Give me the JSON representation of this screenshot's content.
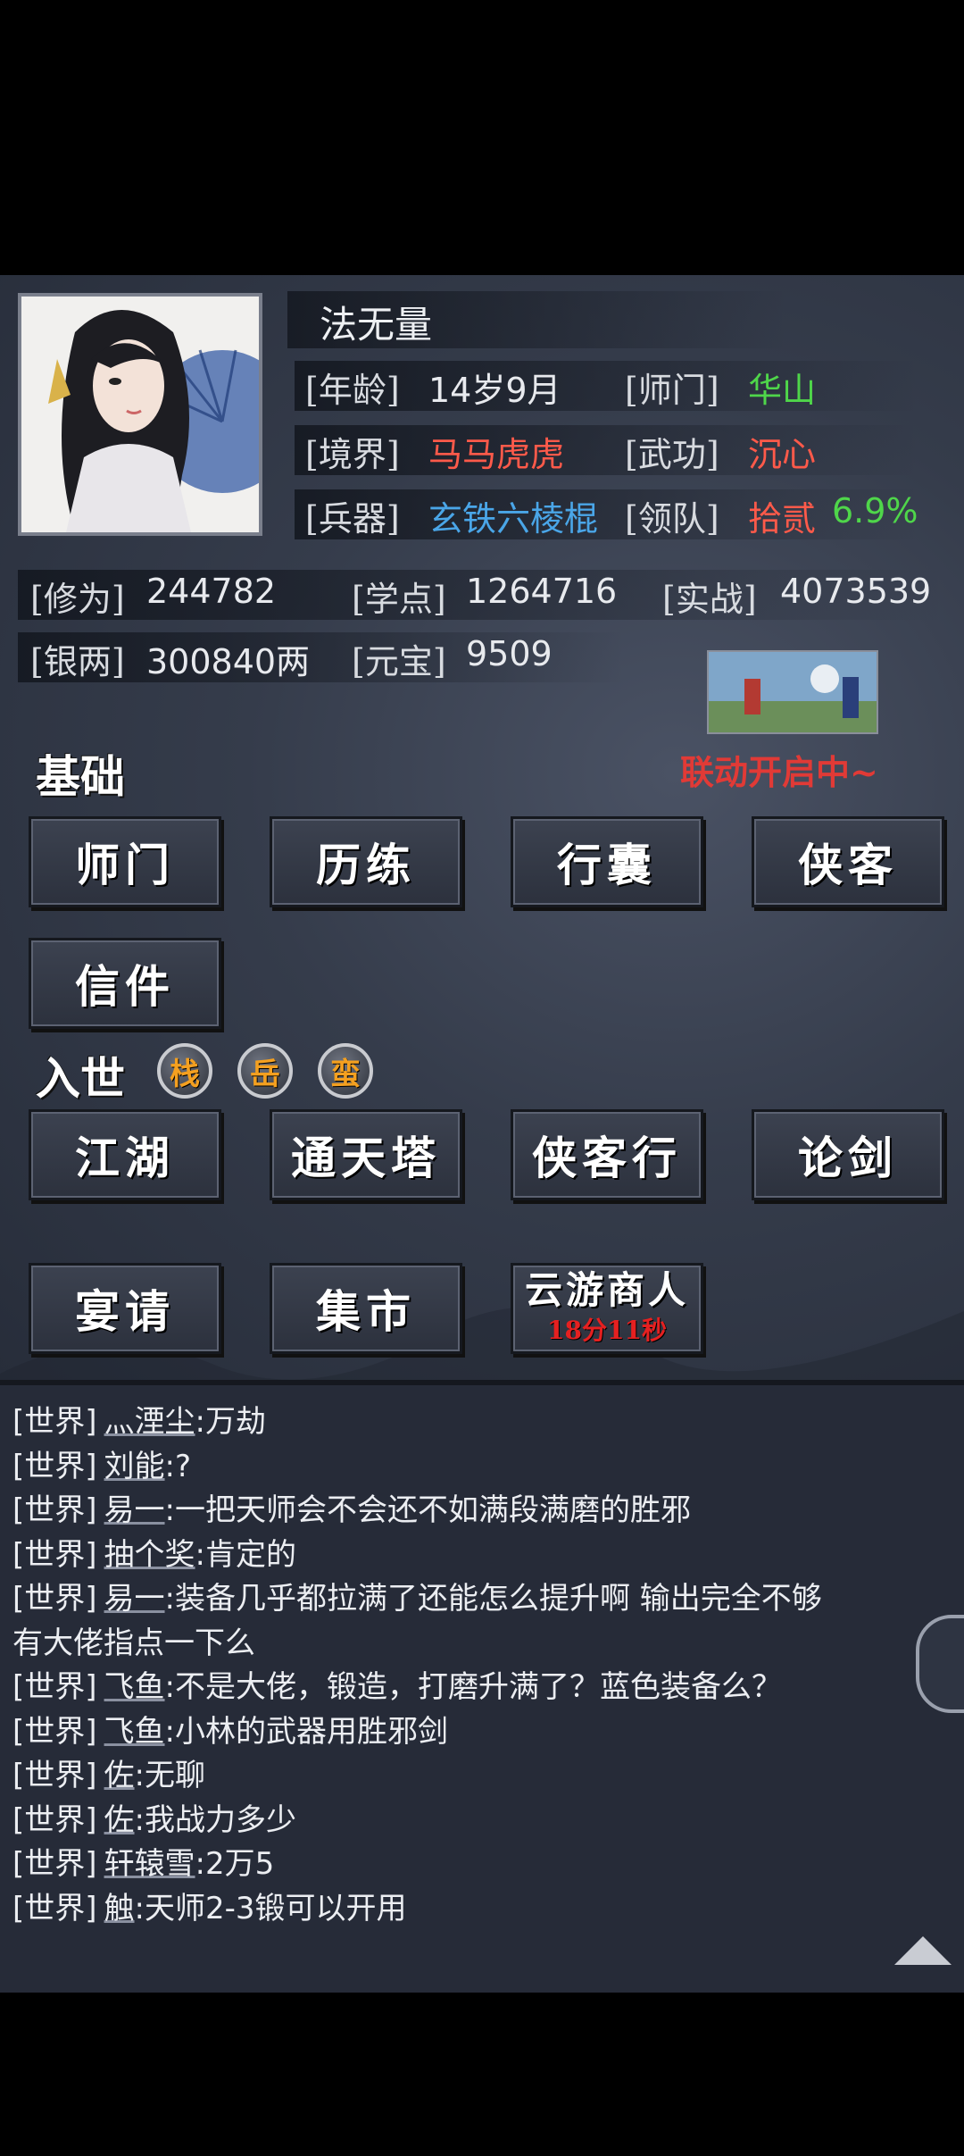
{
  "player": {
    "name": "法无量",
    "age_label": "[年龄]",
    "age": "14岁9月",
    "sect_label": "[师门]",
    "sect": "华山",
    "realm_label": "[境界]",
    "realm": "马马虎虎",
    "skill_label": "[武功]",
    "skill": "沉心",
    "weapon_label": "[兵器]",
    "weapon": "玄铁六棱棍",
    "team_label": "[领队]",
    "team": "拾贰",
    "team_pct": "6.9%",
    "cultivation_label": "[修为]",
    "cultivation": "244782",
    "learn_label": "[学点]",
    "learn": "1264716",
    "combat_label": "[实战]",
    "combat": "4073539",
    "silver_label": "[银两]",
    "silver": "300840两",
    "yuanbao_label": "[元宝]",
    "yuanbao": "9509"
  },
  "event": {
    "text": "联动开启中~"
  },
  "basic": {
    "title": "基础",
    "buttons": [
      "师门",
      "历练",
      "行囊",
      "侠客",
      "信件"
    ]
  },
  "world": {
    "title": "入世",
    "badges": [
      "栈",
      "岳",
      "蛮"
    ],
    "buttons": [
      "江湖",
      "通天塔",
      "侠客行",
      "论剑",
      "宴请",
      "集市"
    ],
    "merchant": {
      "label": "云游商人",
      "timer": "18分11秒"
    }
  },
  "chat": [
    {
      "ch": "[世界]",
      "user": "灬湮尘",
      "msg": ":万劫"
    },
    {
      "ch": "[世界]",
      "user": "刘能",
      "msg": ":?"
    },
    {
      "ch": "[世界]",
      "user": "易一",
      "msg": ":一把天师会不会还不如满段满磨的胜邪"
    },
    {
      "ch": "[世界]",
      "user": "抽个奖",
      "msg": ":肯定的"
    },
    {
      "ch": "[世界]",
      "user": "易一",
      "msg": ":装备几乎都拉满了还能怎么提升啊   输出完全不够"
    },
    {
      "ch": "",
      "user": "",
      "msg": "有大佬指点一下么"
    },
    {
      "ch": "[世界]",
      "user": "飞鱼",
      "msg": ":不是大佬，锻造，打磨升满了？蓝色装备么？"
    },
    {
      "ch": "[世界]",
      "user": "飞鱼",
      "msg": ":小林的武器用胜邪剑"
    },
    {
      "ch": "[世界]",
      "user": "佐",
      "msg": ":无聊"
    },
    {
      "ch": "[世界]",
      "user": "佐",
      "msg": ":我战力多少"
    },
    {
      "ch": "[世界]",
      "user": "轩辕雪",
      "msg": ":2万5"
    },
    {
      "ch": "[世界]",
      "user": "触",
      "msg": ":天师2-3锻可以开用"
    }
  ],
  "colors": {
    "green": "#4fd64a",
    "red": "#ff5a4a",
    "blue": "#4aa6e8",
    "timer": "#e62020"
  }
}
